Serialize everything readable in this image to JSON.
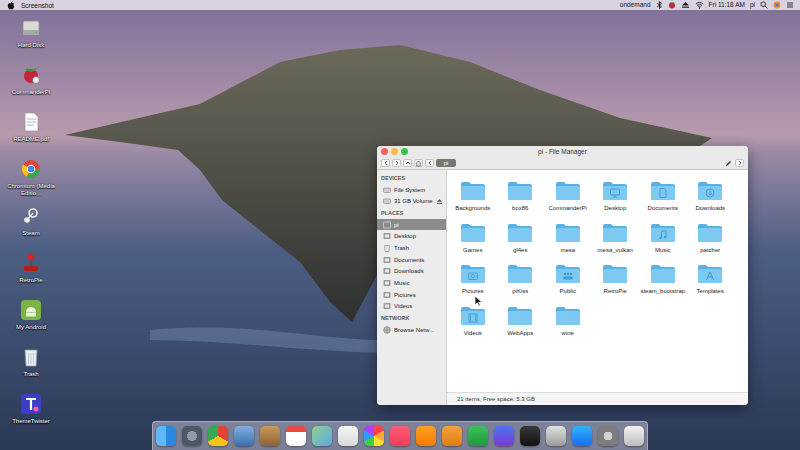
{
  "menubar": {
    "app_name": "Screenshot",
    "governor": "ondemand",
    "clock": "Fri 11:18 AM",
    "user": "pi"
  },
  "desktop_icons": [
    {
      "label": "Hard Disk",
      "kind": "disk",
      "selected": false
    },
    {
      "label": "CommanderPi",
      "kind": "commanderpi",
      "selected": false
    },
    {
      "label": "README.pdf",
      "kind": "pdf",
      "selected": false
    },
    {
      "label": "Chromium (Media Editio...",
      "kind": "chromium",
      "selected": false
    },
    {
      "label": "Steam",
      "kind": "steam",
      "selected": false
    },
    {
      "label": "RetroPie",
      "kind": "retropie",
      "selected": false
    },
    {
      "label": "My Android",
      "kind": "android",
      "selected": false
    },
    {
      "label": "Trash",
      "kind": "trash",
      "selected": false
    },
    {
      "label": "ThemeTwister",
      "kind": "themetwister",
      "selected": false
    }
  ],
  "window": {
    "title": "pi - File Manager",
    "path": "pi",
    "sidebar": [
      {
        "heading": "DEVICES",
        "items": [
          {
            "label": "File System",
            "kind": "drive",
            "selected": false
          },
          {
            "label": "31 GB Volume",
            "kind": "volume",
            "selected": false
          }
        ]
      },
      {
        "heading": "PLACES",
        "items": [
          {
            "label": "pi",
            "kind": "home",
            "selected": true
          },
          {
            "label": "Desktop",
            "kind": "desktop",
            "selected": false
          },
          {
            "label": "Trash",
            "kind": "trash",
            "selected": false
          },
          {
            "label": "Documents",
            "kind": "documents",
            "selected": false
          },
          {
            "label": "Downloads",
            "kind": "downloads",
            "selected": false
          },
          {
            "label": "Music",
            "kind": "music",
            "selected": false
          },
          {
            "label": "Pictures",
            "kind": "pictures",
            "selected": false
          },
          {
            "label": "Videos",
            "kind": "videos",
            "selected": false
          }
        ]
      },
      {
        "heading": "NETWORK",
        "items": [
          {
            "label": "Browse Netw...",
            "kind": "network",
            "selected": false
          }
        ]
      }
    ],
    "items": [
      {
        "label": "Backgrounds",
        "kind": "plain",
        "selected": false
      },
      {
        "label": "box86",
        "kind": "plain",
        "selected": false
      },
      {
        "label": "CommanderPi",
        "kind": "plain",
        "selected": false
      },
      {
        "label": "Desktop",
        "kind": "desktop",
        "selected": false
      },
      {
        "label": "Documents",
        "kind": "documents",
        "selected": false
      },
      {
        "label": "Downloads",
        "kind": "downloads",
        "selected": false
      },
      {
        "label": "Games",
        "kind": "plain",
        "selected": false
      },
      {
        "label": "gl4es",
        "kind": "plain",
        "selected": false
      },
      {
        "label": "mesa",
        "kind": "plain",
        "selected": false
      },
      {
        "label": "mesa_vulkan",
        "kind": "plain",
        "selected": false
      },
      {
        "label": "Music",
        "kind": "music",
        "selected": false
      },
      {
        "label": "patcher",
        "kind": "plain",
        "selected": false
      },
      {
        "label": "Pictures",
        "kind": "pictures",
        "selected": false
      },
      {
        "label": "piKiss",
        "kind": "plain",
        "selected": false
      },
      {
        "label": "Public",
        "kind": "public",
        "selected": false
      },
      {
        "label": "RetroPie",
        "kind": "plain",
        "selected": false
      },
      {
        "label": "steam_bootstrap",
        "kind": "plain",
        "selected": false
      },
      {
        "label": "Templates",
        "kind": "templates",
        "selected": false
      },
      {
        "label": "Videos",
        "kind": "videos",
        "selected": false
      },
      {
        "label": "WebApps",
        "kind": "plain",
        "selected": false
      },
      {
        "label": "wine",
        "kind": "plain",
        "selected": false
      }
    ],
    "status_bar": "21 items, Free space: 5.3 GB"
  },
  "dock": [
    {
      "kind": "finder"
    },
    {
      "kind": "launchpad"
    },
    {
      "kind": "chromium"
    },
    {
      "kind": "preview"
    },
    {
      "kind": "notes"
    },
    {
      "kind": "calendar"
    },
    {
      "kind": "maps"
    },
    {
      "kind": "textedit"
    },
    {
      "kind": "photos"
    },
    {
      "kind": "music"
    },
    {
      "kind": "player"
    },
    {
      "kind": "pages"
    },
    {
      "kind": "numbers"
    },
    {
      "kind": "keynote"
    },
    {
      "kind": "terminal"
    },
    {
      "kind": "archive"
    },
    {
      "kind": "appstore"
    },
    {
      "kind": "preferences"
    },
    {
      "kind": "trash"
    }
  ]
}
